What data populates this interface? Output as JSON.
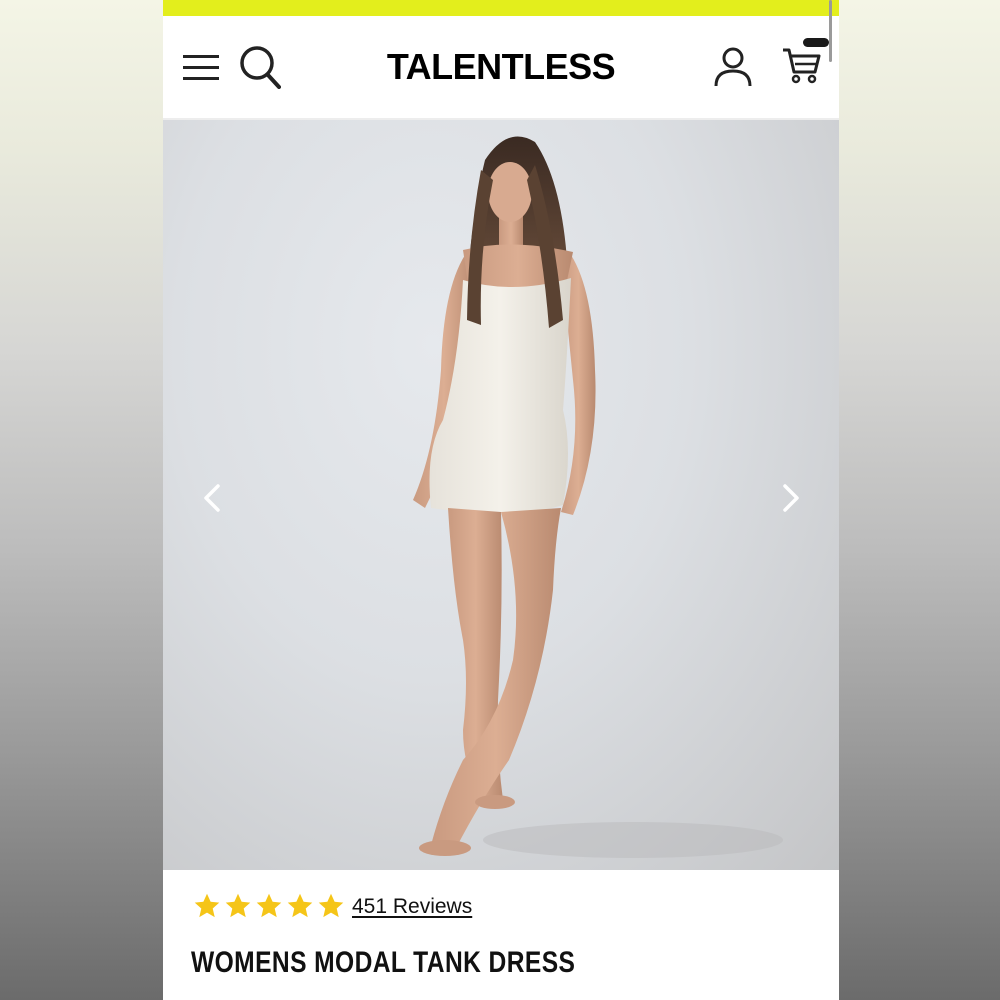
{
  "colors": {
    "promo_bar": "#e3ee1c",
    "star": "#f5c518",
    "text": "#111111"
  },
  "header": {
    "logo": "TALENTLESS",
    "icons": [
      "menu-icon",
      "search-icon",
      "account-icon",
      "cart-icon"
    ]
  },
  "gallery": {
    "image_alt": "Model wearing a white tank dress",
    "prev_icon": "chevron-left-icon",
    "next_icon": "chevron-right-icon"
  },
  "product": {
    "rating": 5,
    "rating_max": 5,
    "reviews_label": "451 Reviews",
    "title": "WOMENS MODAL TANK DRESS"
  }
}
